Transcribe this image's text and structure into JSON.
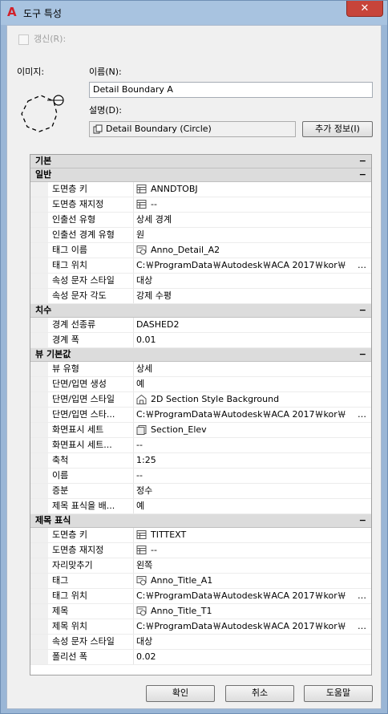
{
  "window": {
    "title": "도구 특성",
    "close_label": "✕",
    "app_icon_letter": "A"
  },
  "update_checkbox": {
    "label": "갱신(R):",
    "checked": false
  },
  "image_label": "이미지:",
  "name": {
    "label": "이름(N):",
    "value": "Detail Boundary A"
  },
  "description": {
    "label": "설명(D):",
    "value": "Detail Boundary (Circle)",
    "more_info_button": "추가 정보(I)"
  },
  "grid": {
    "categories": [
      {
        "title": "기본",
        "toggle": "−"
      },
      {
        "title": "일반",
        "toggle": "−",
        "rows": [
          {
            "name": "도면층 키",
            "value": "ANNDTOBJ",
            "icon": "layer-table-icon"
          },
          {
            "name": "도면층 재지정",
            "value": "--",
            "icon": "layer-table-icon"
          },
          {
            "name": "인출선 유형",
            "value": "상세 경계"
          },
          {
            "name": "인출선 경계 유형",
            "value": "원"
          },
          {
            "name": "태그 이름",
            "value": "Anno_Detail_A2",
            "icon": "block-icon"
          },
          {
            "name": "태그 위치",
            "value": "C:￦ProgramData￦Autodesk￦ACA  2017￦kor￦",
            "ellipsis": "…"
          },
          {
            "name": "속성 문자 스타일",
            "value": "대상"
          },
          {
            "name": "속성 문자 각도",
            "value": "강제 수평"
          }
        ]
      },
      {
        "title": "치수",
        "toggle": "−",
        "rows": [
          {
            "name": "경계 선종류",
            "value": "DASHED2"
          },
          {
            "name": "경계 폭",
            "value": "0.01"
          }
        ]
      },
      {
        "title": "뷰 기본값",
        "toggle": "−",
        "rows": [
          {
            "name": "뷰 유형",
            "value": "상세"
          },
          {
            "name": "단면/입면 생성",
            "value": "예"
          },
          {
            "name": "단면/입면 스타일",
            "value": "2D Section Style Background",
            "icon": "house-icon"
          },
          {
            "name": "단면/입면 스타...",
            "value": "C:￦ProgramData￦Autodesk￦ACA  2017￦kor￦",
            "ellipsis": "…"
          },
          {
            "name": "화면표시 세트",
            "value": "Section_Elev",
            "icon": "display-set-icon"
          },
          {
            "name": "화면표시 세트...",
            "value": "--"
          },
          {
            "name": "축척",
            "value": "1:25"
          },
          {
            "name": "이름",
            "value": "--"
          },
          {
            "name": "증분",
            "value": "정수"
          },
          {
            "name": "제목 표식을 배...",
            "value": "예"
          }
        ]
      },
      {
        "title": "제목 표식",
        "toggle": "−",
        "rows": [
          {
            "name": "도면층 키",
            "value": "TITTEXT",
            "icon": "layer-table-icon"
          },
          {
            "name": "도면층 재지정",
            "value": "--",
            "icon": "layer-table-icon"
          },
          {
            "name": "자리맞추기",
            "value": "왼쪽"
          },
          {
            "name": "태그",
            "value": "Anno_Title_A1",
            "icon": "block-icon"
          },
          {
            "name": "태그 위치",
            "value": "C:￦ProgramData￦Autodesk￦ACA  2017￦kor￦",
            "ellipsis": "…"
          },
          {
            "name": "제목",
            "value": "Anno_Title_T1",
            "icon": "block-icon"
          },
          {
            "name": "제목 위치",
            "value": "C:￦ProgramData￦Autodesk￦ACA  2017￦kor￦",
            "ellipsis": "…"
          },
          {
            "name": "속성 문자 스타일",
            "value": "대상"
          },
          {
            "name": "폴리선 폭",
            "value": "0.02"
          }
        ]
      }
    ]
  },
  "footer": {
    "ok": "확인",
    "cancel": "취소",
    "help": "도움말"
  }
}
